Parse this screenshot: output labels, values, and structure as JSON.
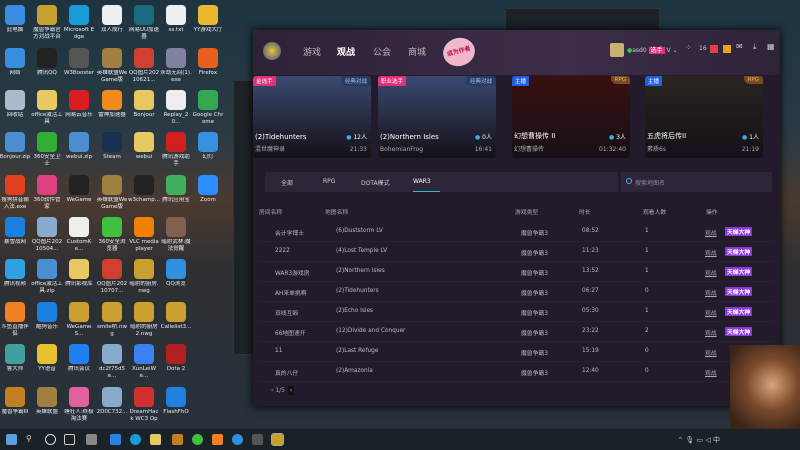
{
  "desktop": {
    "icons": [
      {
        "label": "此电脑",
        "color": "#3a8ee0"
      },
      {
        "label": "魔兽争霸官方对战平台",
        "color": "#c8a030"
      },
      {
        "label": "Microsoft Edge",
        "color": "#1a9ad8"
      },
      {
        "label": "双人成行",
        "color": "#eeeeee"
      },
      {
        "label": "网易UU加速器",
        "color": "#1a6a80"
      },
      {
        "label": "ss.txt",
        "color": "#eeeeee"
      },
      {
        "label": "YY游戏大厅",
        "color": "#e8b830"
      },
      {
        "label": "网络",
        "color": "#3a8ee0"
      },
      {
        "label": "腾讯QQ",
        "color": "#222222"
      },
      {
        "label": "W3Booster",
        "color": "#555555"
      },
      {
        "label": "英雄联盟WeGame版",
        "color": "#a08040"
      },
      {
        "label": "QQ图片20210621...",
        "color": "#d04030"
      },
      {
        "label": "永劫无间(1).exe",
        "color": "#8080a0"
      },
      {
        "label": "Firefox",
        "color": "#e86020"
      },
      {
        "label": "回收站",
        "color": "#aabbcc"
      },
      {
        "label": "office激活工具",
        "color": "#e8c860"
      },
      {
        "label": "网易云音乐",
        "color": "#d81e1e"
      },
      {
        "label": "雷神加速器",
        "color": "#f08a1a"
      },
      {
        "label": "Bonjour",
        "color": "#e8c860"
      },
      {
        "label": "Replay_20...",
        "color": "#eeeeee"
      },
      {
        "label": "Google Chrome",
        "color": "#34a853"
      },
      {
        "label": "Bonjour.zip",
        "color": "#4a90d0"
      },
      {
        "label": "360安全卫士",
        "color": "#30b030"
      },
      {
        "label": "webui.zip",
        "color": "#4a90d0"
      },
      {
        "label": "Steam",
        "color": "#1a3050"
      },
      {
        "label": "webui",
        "color": "#e8c860"
      },
      {
        "label": "腾讯游戏助手",
        "color": "#d02020"
      },
      {
        "label": "幻灯",
        "color": "#3a90e0"
      },
      {
        "label": "搜狗拼音输入法.exe",
        "color": "#e04020"
      },
      {
        "label": "360软件管家",
        "color": "#e04080"
      },
      {
        "label": "WeGame",
        "color": "#222222"
      },
      {
        "label": "英雄联盟WeGame版",
        "color": "#a08040"
      },
      {
        "label": "w3champ...",
        "color": "#222222"
      },
      {
        "label": "腾讯应用宝",
        "color": "#40b060"
      },
      {
        "label": "Zoom",
        "color": "#2d8cff"
      },
      {
        "label": "暴雪战网",
        "color": "#1a80e0"
      },
      {
        "label": "QQ图片20210504...",
        "color": "#88aacc"
      },
      {
        "label": "CustomKe...",
        "color": "#eeeeee"
      },
      {
        "label": "360安全浏览器",
        "color": "#40c040"
      },
      {
        "label": "VLC media player",
        "color": "#f08000"
      },
      {
        "label": "暗射武林:魔法觉醒",
        "color": "#806050"
      },
      {
        "label": "腾讯视频",
        "color": "#30a0e0"
      },
      {
        "label": "office激活工具.zip",
        "color": "#4a90d0"
      },
      {
        "label": "腾讯影视库",
        "color": "#e8c860"
      },
      {
        "label": "QQ图片20210707...",
        "color": "#d04030"
      },
      {
        "label": "暗射的厨房.nwg",
        "color": "#c8a030"
      },
      {
        "label": "QQ浏览",
        "color": "#3090e0"
      },
      {
        "label": "斗鱼直播伴侣",
        "color": "#f08020"
      },
      {
        "label": "酷狗音乐",
        "color": "#1a80e0"
      },
      {
        "label": "WeGameS...",
        "color": "#c8a030"
      },
      {
        "label": "smile桥.nwg",
        "color": "#c8a030"
      },
      {
        "label": "暗射的厨房2.nwg",
        "color": "#c8a030"
      },
      {
        "label": "Callelist3...",
        "color": "#c8a030"
      },
      {
        "label": "鲁大师",
        "color": "#40a0a0"
      },
      {
        "label": "YY语音",
        "color": "#e8c030"
      },
      {
        "label": "腾讯会议",
        "color": "#2080f0"
      },
      {
        "label": "dc2f75d5e...",
        "color": "#88aacc"
      },
      {
        "label": "XunLeiWe...",
        "color": "#3a80f0"
      },
      {
        "label": "Dota 2",
        "color": "#b02020"
      },
      {
        "label": "魔兽争霸III",
        "color": "#c08020"
      },
      {
        "label": "英雄联盟",
        "color": "#a08040"
      },
      {
        "label": "睡狂人:终极淘汰赛",
        "color": "#e060a0"
      },
      {
        "label": "2D0C732...",
        "color": "#88aacc"
      },
      {
        "label": "DreamHack WC3 Ope...",
        "color": "#d03030"
      },
      {
        "label": "FlashFhO",
        "color": "#2080e0"
      }
    ]
  },
  "app": {
    "nav": [
      "游戏",
      "观战",
      "公会",
      "商城"
    ],
    "active_nav": "观战",
    "promo": "成为作者",
    "user": {
      "name": "asd0",
      "badge": "选手",
      "level": "V",
      "count": "16"
    },
    "cards": [
      {
        "tag_left": "金选手",
        "tag_right": "经典对战",
        "name": "(2)Tidehunters",
        "viewers": "12人",
        "host": "混世魔神录",
        "time": "21:33",
        "bg": "#3a4a70"
      },
      {
        "tag_left": "职业选手",
        "tag_right": "经典对战",
        "name": "(2)Northern Isles",
        "viewers": "0人",
        "host": "BohemianFrog",
        "time": "16:41",
        "bg": "#3a4a70"
      },
      {
        "tag_left": "主播",
        "tag_right": "RPG",
        "name": "幻想曹操传 II",
        "viewers": "3人",
        "host": "幻想曹操传",
        "time": "01:32:40",
        "bg": "#3a1010"
      },
      {
        "tag_left": "主播",
        "tag_right": "RPG",
        "name": "五虎将后传II",
        "viewers": "1人",
        "host": "素质6s",
        "time": "21:19",
        "bg": "#2a2420"
      }
    ],
    "tabs": [
      "全部",
      "RPG",
      "DOTA模式",
      "WAR3"
    ],
    "active_tab": "WAR3",
    "search_placeholder": "搜索地图名",
    "columns": [
      "房间名称",
      "地图名称",
      "游戏类型",
      "时长",
      "观看人数",
      "操作"
    ],
    "rows": [
      {
        "room": "会计学博士",
        "map": "(6)Duststorm LV",
        "type": "魔兽争霸3",
        "dur": "08:52",
        "viewers": "1",
        "action": "观战",
        "badge": "天梯大神"
      },
      {
        "room": "2222",
        "map": "(4)Lost Temple LV",
        "type": "魔兽争霸3",
        "dur": "11:23",
        "viewers": "1",
        "action": "观战",
        "badge": "天梯大神"
      },
      {
        "room": "WAR3游戏房",
        "map": "(2)Northern Isles",
        "type": "魔兽争霸3",
        "dur": "13:52",
        "viewers": "1",
        "action": "观战",
        "badge": "天梯大神"
      },
      {
        "room": "AH来单挑啊",
        "map": "(2)Tidehunters",
        "type": "魔兽争霸3",
        "dur": "06:27",
        "viewers": "0",
        "action": "观战",
        "badge": "天梯大神"
      },
      {
        "room": "双线互殴",
        "map": "(2)Echo Isles",
        "type": "魔兽争霸3",
        "dur": "05:30",
        "viewers": "1",
        "action": "观战",
        "badge": "天梯大神"
      },
      {
        "room": "66地图速开",
        "map": "(12)Divide and Conquer",
        "type": "魔兽争霸3",
        "dur": "23:22",
        "viewers": "2",
        "action": "观战",
        "badge": "天梯大神"
      },
      {
        "room": "11",
        "map": "(2)Last Refuge",
        "type": "魔兽争霸3",
        "dur": "15:19",
        "viewers": "0",
        "action": "观战",
        "badge": ""
      },
      {
        "room": "真的八仔",
        "map": "(2)Amazonia",
        "type": "魔兽争霸3",
        "dur": "12:40",
        "viewers": "0",
        "action": "观战",
        "badge": ""
      }
    ],
    "page": "1/5"
  },
  "colors": {
    "accent": "#3ab0e0",
    "badge": "#8a3ad8",
    "app_bg": "#231a2c"
  }
}
